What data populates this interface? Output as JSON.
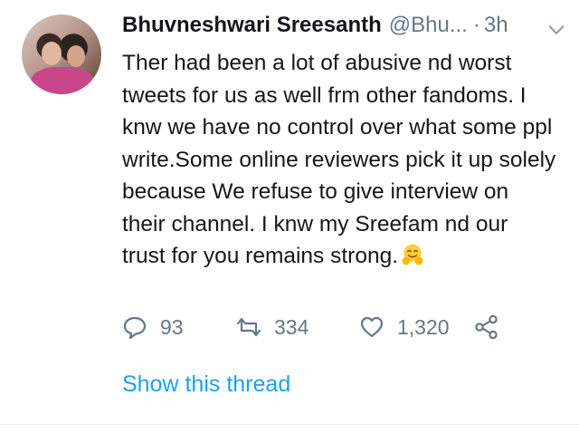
{
  "tweet": {
    "author_name": "Bhuvneshwari Sreesanth",
    "handle": "@Bhu...",
    "separator": "·",
    "time": "3h",
    "text": "Ther had been a lot of abusive nd worst tweets for us as well frm other fandoms. I knw we have no control over what some ppl write.Some online reviewers pick it up solely because We refuse to give interview on their channel. I knw my Sreefam nd our trust for you remains strong.",
    "emoji": "hugging-face-emoji",
    "replies": "93",
    "retweets": "334",
    "likes": "1,320",
    "show_thread": "Show this thread"
  },
  "icons": {
    "reply": "speech-bubble-icon",
    "retweet": "retweet-arrows-icon",
    "like": "heart-outline-icon",
    "share": "share-nodes-icon",
    "menu": "chevron-down-icon"
  },
  "colors": {
    "text": "#14171a",
    "secondary": "#657786",
    "link": "#1da1f2"
  }
}
